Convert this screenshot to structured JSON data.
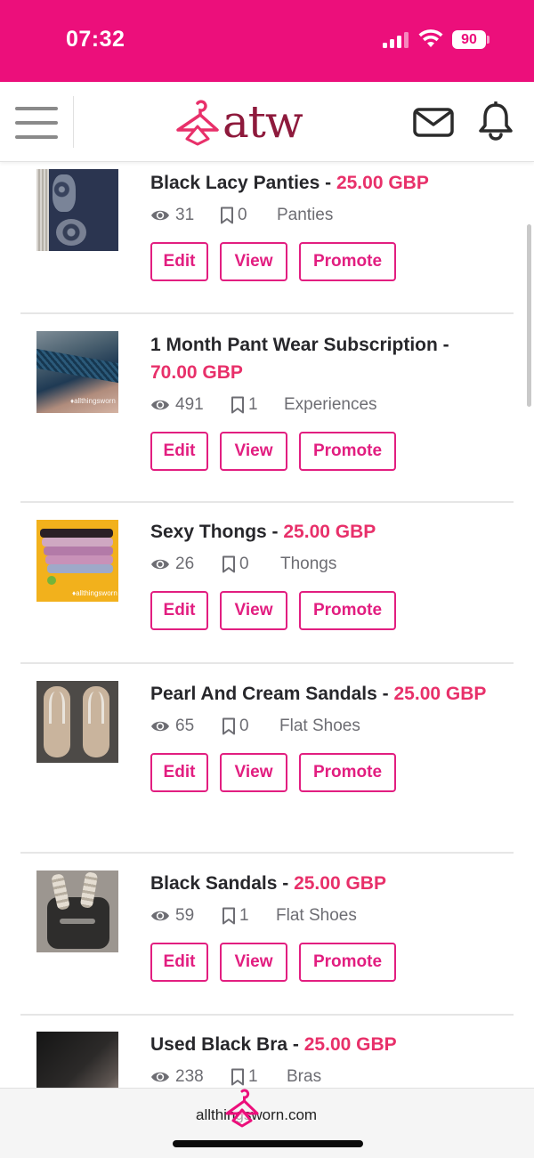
{
  "status_bar": {
    "time": "07:32",
    "battery": "90"
  },
  "header": {
    "logo_text": "atw"
  },
  "listings": [
    {
      "title": "Black Lacy Panties",
      "price": "25.00 GBP",
      "views": "31",
      "saves": "0",
      "category": "Panties",
      "edit_label": "Edit",
      "view_label": "View",
      "promote_label": "Promote"
    },
    {
      "title": "1 Month Pant Wear Subscription",
      "price": "70.00 GBP",
      "views": "491",
      "saves": "1",
      "category": "Experiences",
      "edit_label": "Edit",
      "view_label": "View",
      "promote_label": "Promote"
    },
    {
      "title": "Sexy Thongs",
      "price": "25.00 GBP",
      "views": "26",
      "saves": "0",
      "category": "Thongs",
      "edit_label": "Edit",
      "view_label": "View",
      "promote_label": "Promote"
    },
    {
      "title": "Pearl And Cream Sandals",
      "price": "25.00 GBP",
      "views": "65",
      "saves": "0",
      "category": "Flat Shoes",
      "edit_label": "Edit",
      "view_label": "View",
      "promote_label": "Promote"
    },
    {
      "title": "Black Sandals",
      "price": "25.00 GBP",
      "views": "59",
      "saves": "1",
      "category": "Flat Shoes",
      "edit_label": "Edit",
      "view_label": "View",
      "promote_label": "Promote"
    },
    {
      "title": "Used Black Bra",
      "price": "25.00 GBP",
      "views": "238",
      "saves": "1",
      "category": "Bras"
    }
  ],
  "footer": {
    "site": "allthingsworn.com"
  },
  "colors": {
    "brand_pink": "#ec0f7b",
    "button_pink": "#e21e80",
    "price_pink": "#e8306a",
    "logo_maroon": "#8e1a3c"
  },
  "icons": [
    "menu-icon",
    "hanger-icon",
    "mail-icon",
    "bell-icon",
    "eye-icon",
    "bookmark-icon"
  ]
}
